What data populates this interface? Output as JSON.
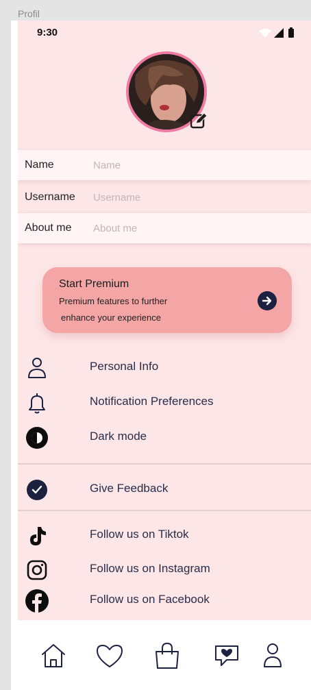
{
  "frame_label": "Profil",
  "status_bar": {
    "time": "9:30"
  },
  "profile": {
    "fields": [
      {
        "label": "Name",
        "placeholder": "Name"
      },
      {
        "label": "Username",
        "placeholder": "Username"
      },
      {
        "label": "About me",
        "placeholder": "About me"
      }
    ]
  },
  "premium": {
    "title": "Start Premium",
    "line1": "Premium features to further",
    "line2": "enhance your experience"
  },
  "menu": {
    "personal_info": "Personal Info",
    "notifications": "Notification Preferences",
    "dark_mode": "Dark mode",
    "feedback": "Give Feedback",
    "tiktok": "Follow us on Tiktok",
    "instagram": "Follow us on Instagram",
    "facebook": "Follow us on Facebook"
  },
  "icons": {
    "personal_info": "user-icon",
    "notifications": "bell-icon",
    "dark_mode": "contrast-icon",
    "feedback": "check-circle-icon",
    "tiktok": "tiktok-icon",
    "instagram": "instagram-icon",
    "facebook": "facebook-icon",
    "nav": [
      "home-icon",
      "heart-icon",
      "shopping-bag-icon",
      "chat-heart-icon",
      "profile-icon"
    ]
  },
  "colors": {
    "background": "#fde6e7",
    "accent": "#f4a6a6",
    "avatar_border": "#ef7aa3",
    "icon_dark": "#1c2140"
  }
}
